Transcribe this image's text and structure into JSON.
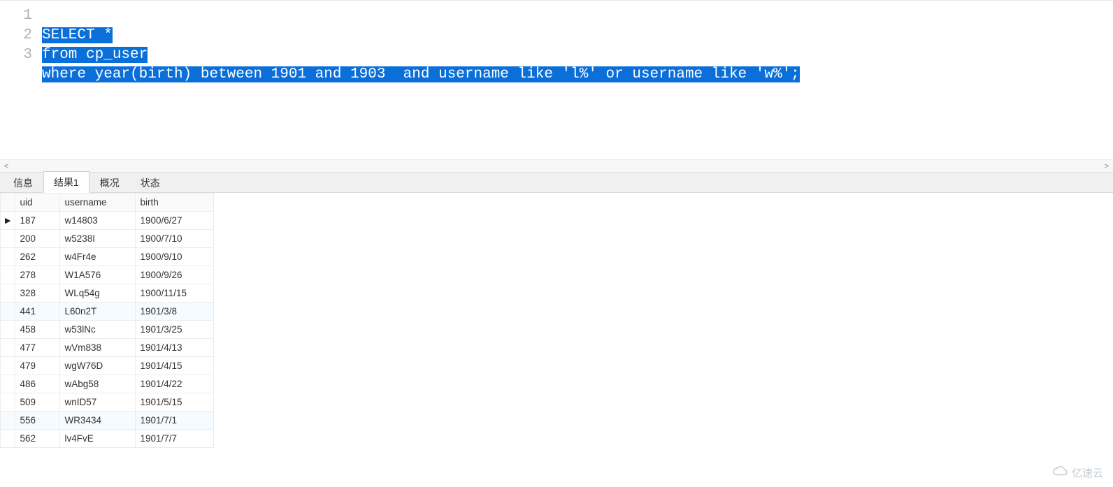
{
  "editor": {
    "lines": [
      {
        "n": "1",
        "text": "SELECT *"
      },
      {
        "n": "2",
        "text": "from cp_user"
      },
      {
        "n": "3",
        "text": "where year(birth) between 1901 and 1903  and username like 'l%' or username like 'w%';"
      }
    ]
  },
  "tabs": {
    "items": [
      {
        "label": "信息",
        "active": false
      },
      {
        "label": "结果1",
        "active": true
      },
      {
        "label": "概况",
        "active": false
      },
      {
        "label": "状态",
        "active": false
      }
    ]
  },
  "grid": {
    "columns": [
      "uid",
      "username",
      "birth"
    ],
    "current_row_index": 0,
    "hover_rows": [
      5,
      11
    ],
    "rows": [
      {
        "uid": "187",
        "username": "w14803",
        "birth": "1900/6/27"
      },
      {
        "uid": "200",
        "username": "w5238I",
        "birth": "1900/7/10"
      },
      {
        "uid": "262",
        "username": "w4Fr4e",
        "birth": "1900/9/10"
      },
      {
        "uid": "278",
        "username": "W1A576",
        "birth": "1900/9/26"
      },
      {
        "uid": "328",
        "username": "WLq54g",
        "birth": "1900/11/15"
      },
      {
        "uid": "441",
        "username": "L60n2T",
        "birth": "1901/3/8"
      },
      {
        "uid": "458",
        "username": "w53lNc",
        "birth": "1901/3/25"
      },
      {
        "uid": "477",
        "username": "wVm838",
        "birth": "1901/4/13"
      },
      {
        "uid": "479",
        "username": "wgW76D",
        "birth": "1901/4/15"
      },
      {
        "uid": "486",
        "username": "wAbg58",
        "birth": "1901/4/22"
      },
      {
        "uid": "509",
        "username": "wnID57",
        "birth": "1901/5/15"
      },
      {
        "uid": "556",
        "username": "WR3434",
        "birth": "1901/7/1"
      },
      {
        "uid": "562",
        "username": "lv4FvE",
        "birth": "1901/7/7"
      }
    ]
  },
  "watermark": {
    "text": "亿速云"
  },
  "hscroll": {
    "left_glyph": "<",
    "right_glyph": ">"
  }
}
